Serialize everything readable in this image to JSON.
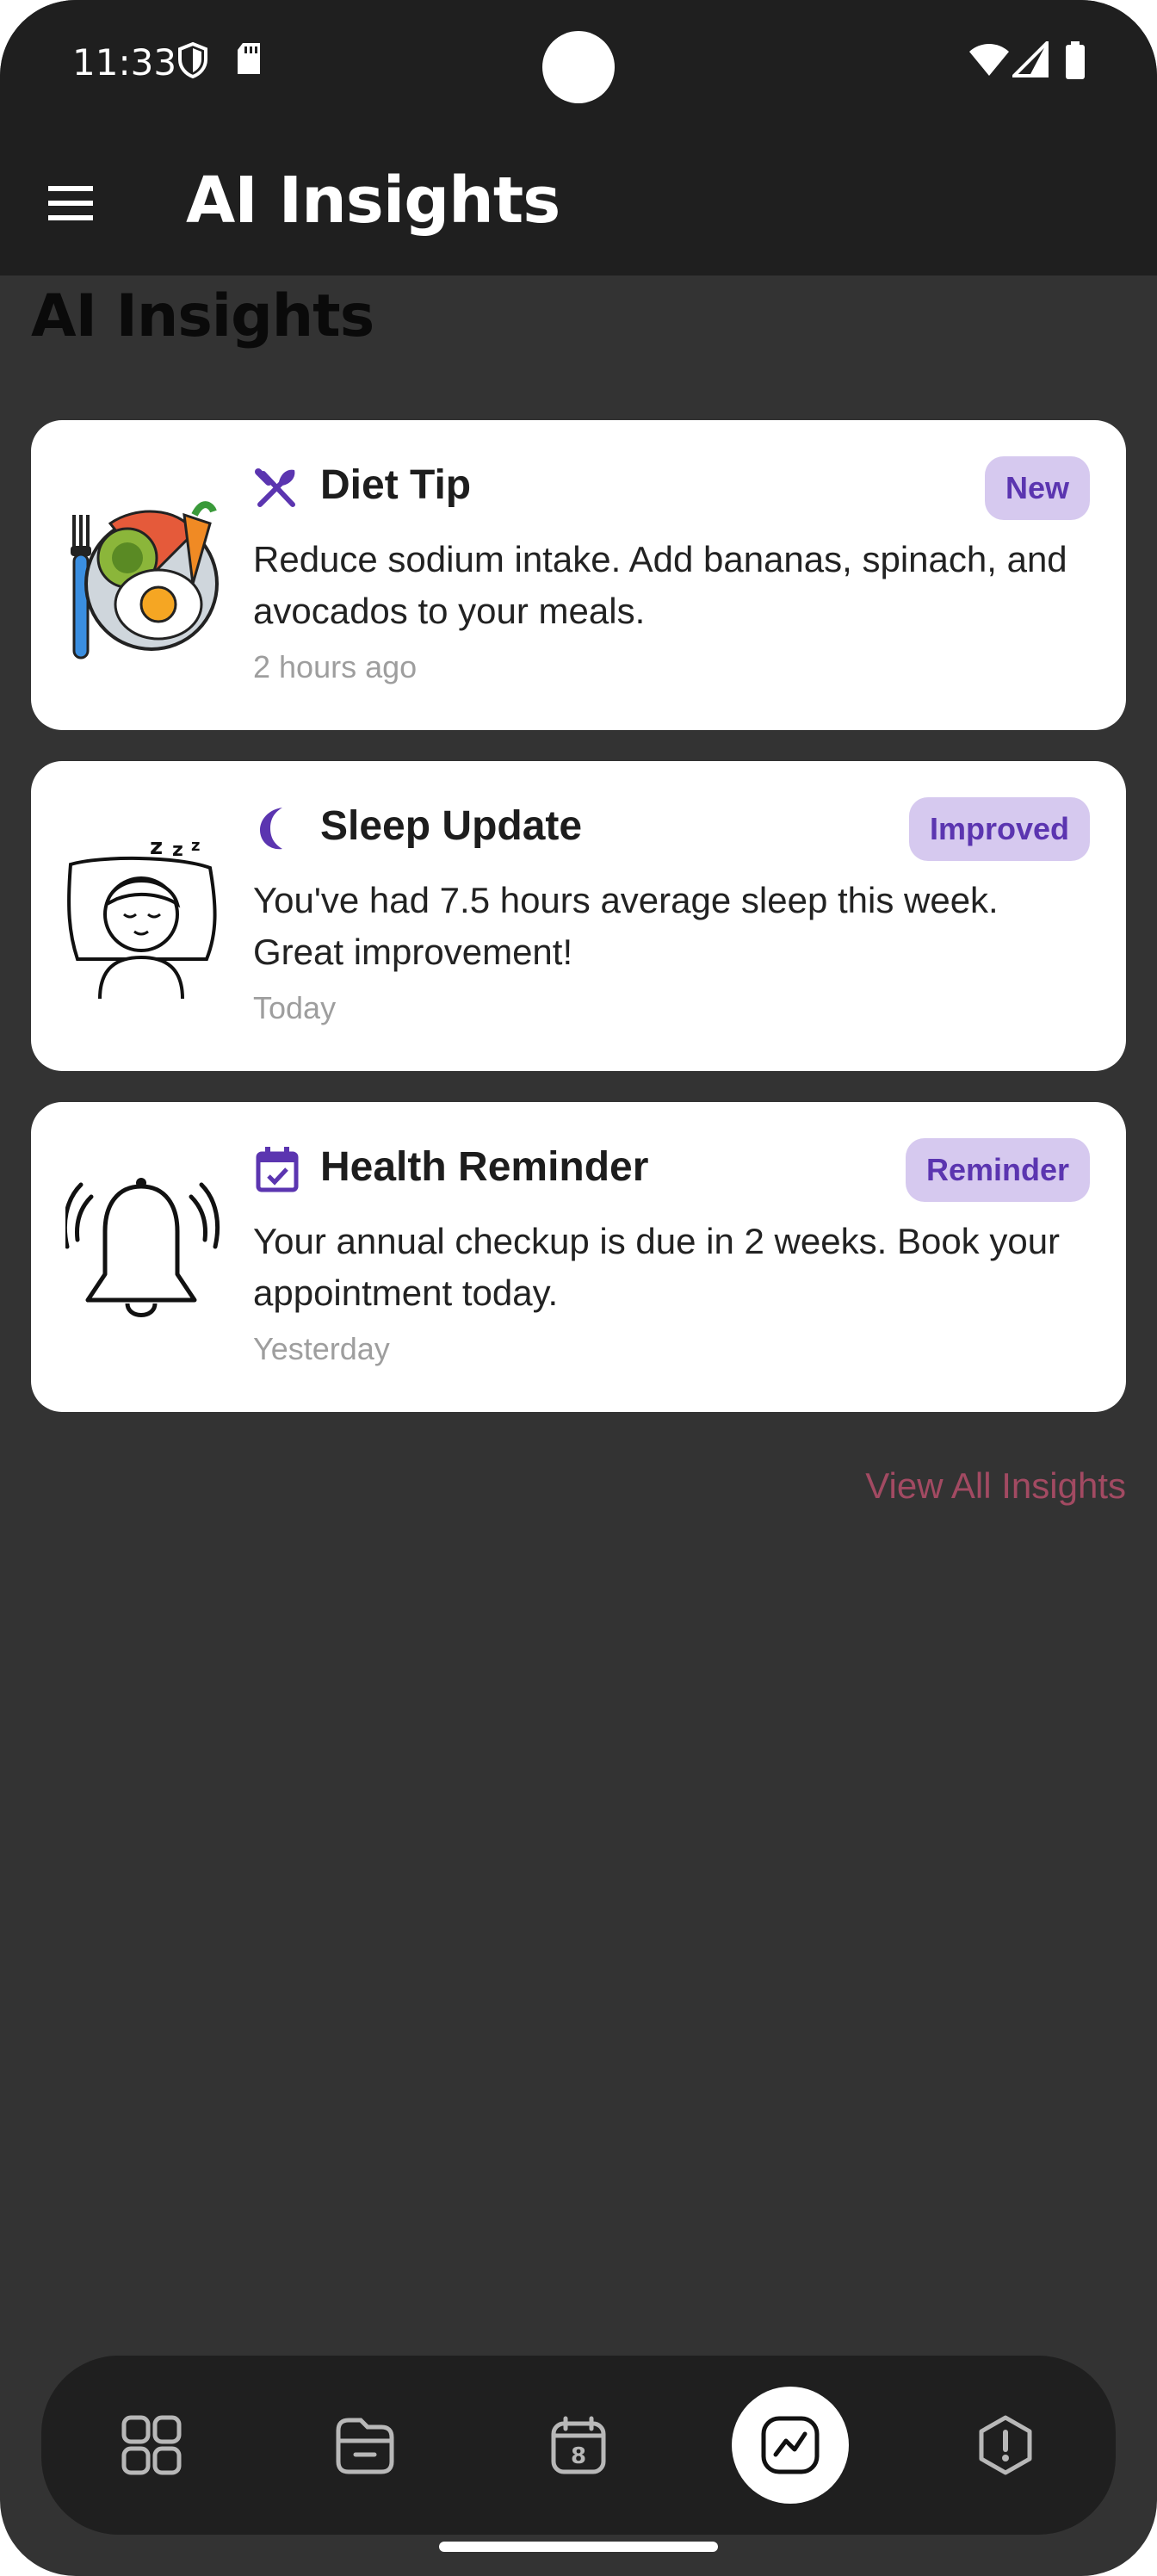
{
  "status_bar": {
    "time": "11:33",
    "icons": [
      "shield-icon",
      "sd-card-icon",
      "wifi-icon",
      "signal-icon",
      "battery-icon"
    ]
  },
  "app_bar": {
    "title": "AI Insights",
    "menu_icon": "hamburger-menu-icon"
  },
  "page": {
    "title": "AI Insights"
  },
  "insights": [
    {
      "title": "Diet Tip",
      "icon": "utensils-icon",
      "illustration": "meal-plate-illustration",
      "badge": "New",
      "body": "Reduce sodium intake. Add bananas, spinach, and avocados to your meals.",
      "time": "2 hours ago"
    },
    {
      "title": "Sleep Update",
      "icon": "moon-icon",
      "illustration": "sleeping-person-illustration",
      "badge": "Improved",
      "body": "You've had 7.5 hours average sleep this week. Great improvement!",
      "time": "Today"
    },
    {
      "title": "Health Reminder",
      "icon": "calendar-check-icon",
      "illustration": "bell-illustration",
      "badge": "Reminder",
      "body": "Your annual checkup is due in 2 weeks. Book your appointment today.",
      "time": "Yesterday"
    }
  ],
  "view_all_label": "View All Insights",
  "bottom_nav": {
    "items": [
      "dashboard-icon",
      "records-folder-icon",
      "calendar-icon",
      "insights-chart-icon",
      "alerts-icon"
    ],
    "calendar_day": "8",
    "active": "insights-chart-icon"
  },
  "colors": {
    "background": "#333333",
    "app_bar": "#1f1f1f",
    "accent": "#5b35b0",
    "badge_bg": "#d6c9ef",
    "link": "#a24a62"
  }
}
